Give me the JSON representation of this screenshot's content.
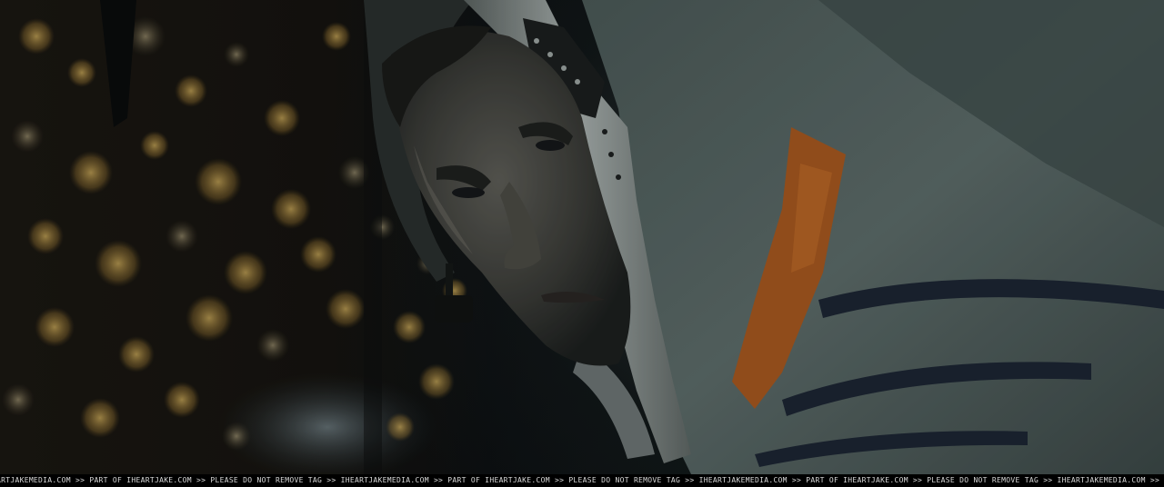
{
  "image": {
    "description_colors": {
      "bokeh": "#c9a24a",
      "suit": "#4c5a58",
      "harness": "#a4571f",
      "helmet_ring": "#8c9492",
      "background": "#0b0f0f"
    }
  },
  "watermark": {
    "text": "ARTJAKEMEDIA.COM >> PART OF IHEARTJAKE.COM >> PLEASE DO NOT REMOVE TAG >> IHEARTJAKEMEDIA.COM >> PART OF IHEARTJAKE.COM >> PLEASE DO NOT REMOVE TAG >> IHEARTJAKEMEDIA.COM >> PART OF IHEARTJAKE.COM >> PLEASE DO NOT REMOVE TAG >> IHEARTJAKEMEDIA.COM >> PART OF IHEARTJAKE.COM >> PLEASE"
  }
}
